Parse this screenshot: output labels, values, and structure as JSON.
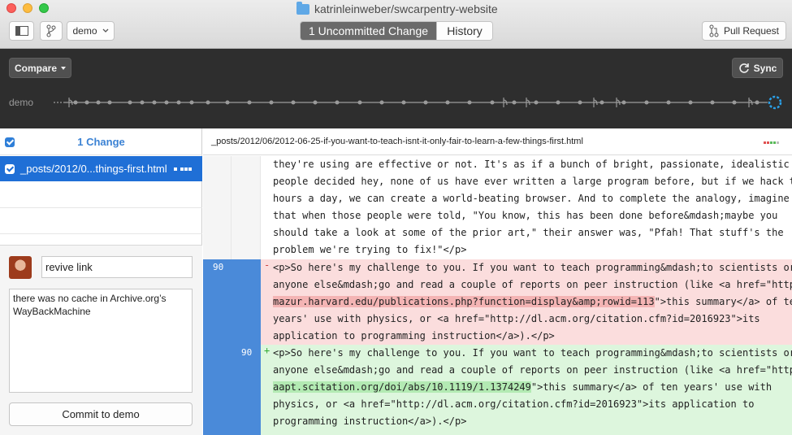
{
  "window": {
    "repo_title": "katrinleinweber/swcarpentry-website"
  },
  "toolbar": {
    "branch": "demo",
    "tabs": [
      {
        "label": "1 Uncommitted Change",
        "active": true
      },
      {
        "label": "History",
        "active": false
      }
    ],
    "pull_request": "Pull Request"
  },
  "history_bar": {
    "compare": "Compare",
    "sync": "Sync",
    "branch_label": "demo"
  },
  "changes": {
    "header": "1 Change",
    "files": [
      {
        "name": "_posts/2012/0...things-first.html",
        "checked": true
      }
    ]
  },
  "commit": {
    "summary": "revive link",
    "description": "there was no cache in Archive.org’s WayBackMachine",
    "button": "Commit to demo"
  },
  "diff": {
    "path": "_posts/2012/06/2012-06-25-if-you-want-to-teach-isnt-it-only-fair-to-learn-a-few-things-first.html",
    "context_lines": [
      "they're using are effective or not. It's as if a bunch of bright, passionate, idealistic",
      "people decided hey, none of us have ever written a large program before, but if we hack ten",
      "hours a day, we can create a world-beating browser. And to complete the analogy, imagine",
      "that when those people were told, \"You know, this has been done before&mdash;maybe you",
      "should take a look at some of the prior art,\" their answer was, \"Pfah! That stuff's the",
      "problem we're trying to fix!\"</p>"
    ],
    "deleted": {
      "old_line": "90",
      "marker": "-",
      "lines": [
        "<p>So here's my challenge to you. If you want to teach programming&mdash;to scientists or",
        "anyone else&mdash;go and read a couple of reports on peer instruction (like <a href=\"http://",
        "mazur.harvard.edu/publications.php?function=display&amp;rowid=113",
        "\">this summary</a> of ten",
        "years' use with physics, or <a href=\"http://dl.acm.org/citation.cfm?id=2016923\">its",
        "application to programming instruction</a>).</p>"
      ]
    },
    "added": {
      "new_line": "90",
      "marker": "+",
      "lines": [
        "<p>So here's my challenge to you. If you want to teach programming&mdash;to scientists or",
        "anyone else&mdash;go and read a couple of reports on peer instruction (like <a href=\"http://",
        "aapt.scitation.org/doi/abs/10.1119/1.1374249",
        "\">this summary</a> of ten years' use with",
        "physics, or <a href=\"http://dl.acm.org/citation.cfm?id=2016923\">its application to",
        "programming instruction</a>).</p>"
      ]
    }
  },
  "colors": {
    "accent": "#1f6fd6",
    "deleted_bg": "#fbdddd",
    "added_bg": "#ddf6dd",
    "gutter_blue": "#4a8ad9"
  }
}
